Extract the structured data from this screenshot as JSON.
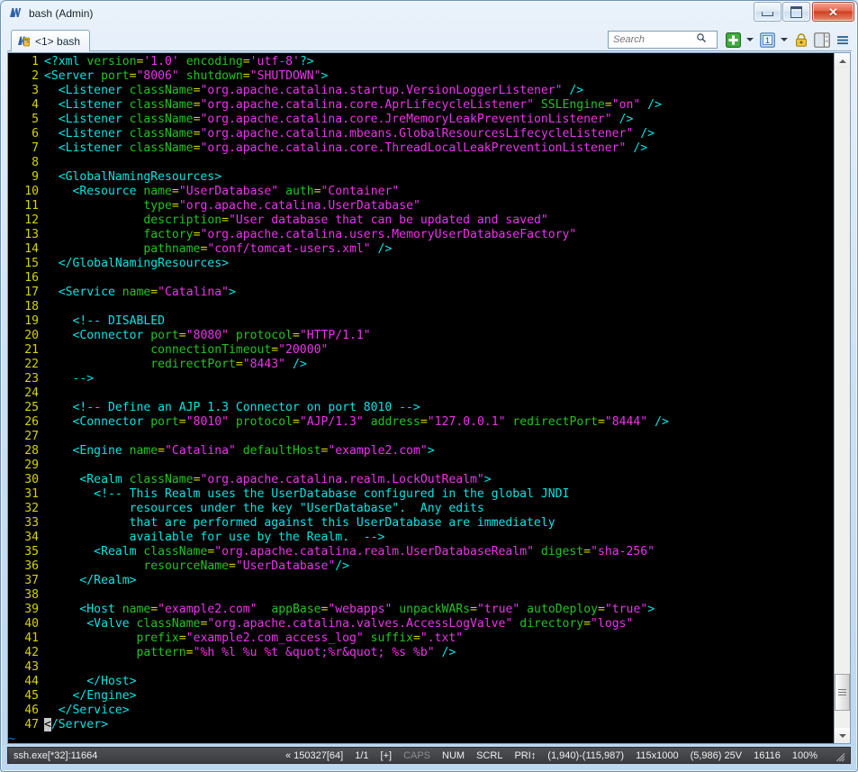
{
  "window": {
    "title": "bash (Admin)",
    "icon": "mobaxterm-icon",
    "buttons": {
      "minimize": "minimize-button",
      "maximize": "maximize-button",
      "close": "✕"
    }
  },
  "tabs": [
    {
      "label": "<1> bash",
      "icon": "terminal-session-icon",
      "active": true
    }
  ],
  "toolbar": {
    "search": {
      "placeholder": "Search",
      "value": ""
    },
    "search_icon": "magnifier-icon",
    "new_session_icon": "green-plus-icon",
    "new_session_caret": "▾",
    "split_count_label": "1",
    "split_caret": "▾",
    "lock_icon": "padlock-icon",
    "panes_icon": "split-panes-icon",
    "menu_icon": "hamburger-menu-icon"
  },
  "statusbar": {
    "process": "ssh.exe[*32]:11664",
    "session_marker": "«",
    "build": "150327[64]",
    "pane_ratio": "1/1",
    "expand": "[+]",
    "caps": "CAPS",
    "num": "NUM",
    "scrl": "SCRL",
    "pri": "PRI↕",
    "range": "(1,940)-(115,987)",
    "size": "115x1000",
    "position": "(5,986) 25V",
    "bytes": "16116",
    "zoom": "100%"
  },
  "scrollbar": {
    "up_arrow": "scroll-up-arrow",
    "down_arrow": "scroll-down-arrow",
    "thumb": "scroll-thumb"
  },
  "terminal": {
    "cursor_char": "<",
    "tilde_row": "~",
    "colors": {
      "background": "#000000",
      "line_number": "#d4d400",
      "tag": "#00e5e5",
      "attribute": "#22c422",
      "value": "#ee33ee",
      "cursor": "#c8c8c8",
      "tilde": "#1e7fdd"
    },
    "lines": [
      {
        "n": 1,
        "seg": [
          [
            "tag",
            "<?xml "
          ],
          [
            "attr",
            "version"
          ],
          [
            "eq",
            "="
          ],
          [
            "val",
            "'1.0'"
          ],
          [
            "tag",
            " "
          ],
          [
            "attr",
            "encoding"
          ],
          [
            "eq",
            "="
          ],
          [
            "val",
            "'utf-8'"
          ],
          [
            "tag",
            "?>"
          ]
        ]
      },
      {
        "n": 2,
        "seg": [
          [
            "tag",
            "<Server "
          ],
          [
            "attr",
            "port"
          ],
          [
            "eq",
            "="
          ],
          [
            "val",
            "\"8006\""
          ],
          [
            "tag",
            " "
          ],
          [
            "attr",
            "shutdown"
          ],
          [
            "eq",
            "="
          ],
          [
            "val",
            "\"SHUTDOWN\""
          ],
          [
            "tag",
            ">"
          ]
        ]
      },
      {
        "n": 3,
        "seg": [
          [
            "tag",
            "  <Listener "
          ],
          [
            "attr",
            "className"
          ],
          [
            "eq",
            "="
          ],
          [
            "val",
            "\"org.apache.catalina.startup.VersionLoggerListener\""
          ],
          [
            "tag",
            " />"
          ]
        ]
      },
      {
        "n": 4,
        "seg": [
          [
            "tag",
            "  <Listener "
          ],
          [
            "attr",
            "className"
          ],
          [
            "eq",
            "="
          ],
          [
            "val",
            "\"org.apache.catalina.core.AprLifecycleListener\""
          ],
          [
            "tag",
            " "
          ],
          [
            "attr",
            "SSLEngine"
          ],
          [
            "eq",
            "="
          ],
          [
            "val",
            "\"on\""
          ],
          [
            "tag",
            " />"
          ]
        ]
      },
      {
        "n": 5,
        "seg": [
          [
            "tag",
            "  <Listener "
          ],
          [
            "attr",
            "className"
          ],
          [
            "eq",
            "="
          ],
          [
            "val",
            "\"org.apache.catalina.core.JreMemoryLeakPreventionListener\""
          ],
          [
            "tag",
            " />"
          ]
        ]
      },
      {
        "n": 6,
        "seg": [
          [
            "tag",
            "  <Listener "
          ],
          [
            "attr",
            "className"
          ],
          [
            "eq",
            "="
          ],
          [
            "val",
            "\"org.apache.catalina.mbeans.GlobalResourcesLifecycleListener\""
          ],
          [
            "tag",
            " />"
          ]
        ]
      },
      {
        "n": 7,
        "seg": [
          [
            "tag",
            "  <Listener "
          ],
          [
            "attr",
            "className"
          ],
          [
            "eq",
            "="
          ],
          [
            "val",
            "\"org.apache.catalina.core.ThreadLocalLeakPreventionListener\""
          ],
          [
            "tag",
            " />"
          ]
        ]
      },
      {
        "n": 8,
        "seg": []
      },
      {
        "n": 9,
        "seg": [
          [
            "tag",
            "  <GlobalNamingResources>"
          ]
        ]
      },
      {
        "n": 10,
        "seg": [
          [
            "tag",
            "    <Resource "
          ],
          [
            "attr",
            "name"
          ],
          [
            "eq",
            "="
          ],
          [
            "val",
            "\"UserDatabase\""
          ],
          [
            "tag",
            " "
          ],
          [
            "attr",
            "auth"
          ],
          [
            "eq",
            "="
          ],
          [
            "val",
            "\"Container\""
          ]
        ]
      },
      {
        "n": 11,
        "seg": [
          [
            "tag",
            "              "
          ],
          [
            "attr",
            "type"
          ],
          [
            "eq",
            "="
          ],
          [
            "val",
            "\"org.apache.catalina.UserDatabase\""
          ]
        ]
      },
      {
        "n": 12,
        "seg": [
          [
            "tag",
            "              "
          ],
          [
            "attr",
            "description"
          ],
          [
            "eq",
            "="
          ],
          [
            "val",
            "\"User database that can be updated and saved\""
          ]
        ]
      },
      {
        "n": 13,
        "seg": [
          [
            "tag",
            "              "
          ],
          [
            "attr",
            "factory"
          ],
          [
            "eq",
            "="
          ],
          [
            "val",
            "\"org.apache.catalina.users.MemoryUserDatabaseFactory\""
          ]
        ]
      },
      {
        "n": 14,
        "seg": [
          [
            "tag",
            "              "
          ],
          [
            "attr",
            "pathname"
          ],
          [
            "eq",
            "="
          ],
          [
            "val",
            "\"conf/tomcat-users.xml\""
          ],
          [
            "tag",
            " />"
          ]
        ]
      },
      {
        "n": 15,
        "seg": [
          [
            "tag",
            "  </GlobalNamingResources>"
          ]
        ]
      },
      {
        "n": 16,
        "seg": []
      },
      {
        "n": 17,
        "seg": [
          [
            "tag",
            "  <Service "
          ],
          [
            "attr",
            "name"
          ],
          [
            "eq",
            "="
          ],
          [
            "val",
            "\"Catalina\""
          ],
          [
            "tag",
            ">"
          ]
        ]
      },
      {
        "n": 18,
        "seg": []
      },
      {
        "n": 19,
        "seg": [
          [
            "tag",
            "    <!-- DISABLED"
          ]
        ]
      },
      {
        "n": 20,
        "seg": [
          [
            "tag",
            "    <Connector "
          ],
          [
            "attr",
            "port"
          ],
          [
            "eq",
            "="
          ],
          [
            "val",
            "\"8080\""
          ],
          [
            "tag",
            " "
          ],
          [
            "attr",
            "protocol"
          ],
          [
            "eq",
            "="
          ],
          [
            "val",
            "\"HTTP/1.1\""
          ]
        ]
      },
      {
        "n": 21,
        "seg": [
          [
            "tag",
            "               "
          ],
          [
            "attr",
            "connectionTimeout"
          ],
          [
            "eq",
            "="
          ],
          [
            "val",
            "\"20000\""
          ]
        ]
      },
      {
        "n": 22,
        "seg": [
          [
            "tag",
            "               "
          ],
          [
            "attr",
            "redirectPort"
          ],
          [
            "eq",
            "="
          ],
          [
            "val",
            "\"8443\""
          ],
          [
            "tag",
            " />"
          ]
        ]
      },
      {
        "n": 23,
        "seg": [
          [
            "tag",
            "    -->"
          ]
        ]
      },
      {
        "n": 24,
        "seg": []
      },
      {
        "n": 25,
        "seg": [
          [
            "tag",
            "    <!-- Define an AJP 1.3 Connector on port 8010 -->"
          ]
        ]
      },
      {
        "n": 26,
        "seg": [
          [
            "tag",
            "    <Connector "
          ],
          [
            "attr",
            "port"
          ],
          [
            "eq",
            "="
          ],
          [
            "val",
            "\"8010\""
          ],
          [
            "tag",
            " "
          ],
          [
            "attr",
            "protocol"
          ],
          [
            "eq",
            "="
          ],
          [
            "val",
            "\"AJP/1.3\""
          ],
          [
            "tag",
            " "
          ],
          [
            "attr",
            "address"
          ],
          [
            "eq",
            "="
          ],
          [
            "val",
            "\"127.0.0.1\""
          ],
          [
            "tag",
            " "
          ],
          [
            "attr",
            "redirectPort"
          ],
          [
            "eq",
            "="
          ],
          [
            "val",
            "\"8444\""
          ],
          [
            "tag",
            " />"
          ]
        ]
      },
      {
        "n": 27,
        "seg": []
      },
      {
        "n": 28,
        "seg": [
          [
            "tag",
            "    <Engine "
          ],
          [
            "attr",
            "name"
          ],
          [
            "eq",
            "="
          ],
          [
            "val",
            "\"Catalina\""
          ],
          [
            "tag",
            " "
          ],
          [
            "attr",
            "defaultHost"
          ],
          [
            "eq",
            "="
          ],
          [
            "val",
            "\"example2.com\""
          ],
          [
            "tag",
            ">"
          ]
        ]
      },
      {
        "n": 29,
        "seg": []
      },
      {
        "n": 30,
        "seg": [
          [
            "tag",
            "     <Realm "
          ],
          [
            "attr",
            "className"
          ],
          [
            "eq",
            "="
          ],
          [
            "val",
            "\"org.apache.catalina.realm.LockOutRealm\""
          ],
          [
            "tag",
            ">"
          ]
        ]
      },
      {
        "n": 31,
        "seg": [
          [
            "tag",
            "       <!-- This Realm uses the UserDatabase configured in the global JNDI"
          ]
        ]
      },
      {
        "n": 32,
        "seg": [
          [
            "tag",
            "            resources under the key \"UserDatabase\".  Any edits"
          ]
        ]
      },
      {
        "n": 33,
        "seg": [
          [
            "tag",
            "            that are performed against this UserDatabase are immediately"
          ]
        ]
      },
      {
        "n": 34,
        "seg": [
          [
            "tag",
            "            available for use by the Realm.  -->"
          ]
        ]
      },
      {
        "n": 35,
        "seg": [
          [
            "tag",
            "       <Realm "
          ],
          [
            "attr",
            "className"
          ],
          [
            "eq",
            "="
          ],
          [
            "val",
            "\"org.apache.catalina.realm.UserDatabaseRealm\""
          ],
          [
            "tag",
            " "
          ],
          [
            "attr",
            "digest"
          ],
          [
            "eq",
            "="
          ],
          [
            "val",
            "\"sha-256\""
          ]
        ]
      },
      {
        "n": 36,
        "seg": [
          [
            "tag",
            "              "
          ],
          [
            "attr",
            "resourceName"
          ],
          [
            "eq",
            "="
          ],
          [
            "val",
            "\"UserDatabase\""
          ],
          [
            "tag",
            "/>"
          ]
        ]
      },
      {
        "n": 37,
        "seg": [
          [
            "tag",
            "     </Realm>"
          ]
        ]
      },
      {
        "n": 38,
        "seg": []
      },
      {
        "n": 39,
        "seg": [
          [
            "tag",
            "     <Host "
          ],
          [
            "attr",
            "name"
          ],
          [
            "eq",
            "="
          ],
          [
            "val",
            "\"example2.com\""
          ],
          [
            "tag",
            "  "
          ],
          [
            "attr",
            "appBase"
          ],
          [
            "eq",
            "="
          ],
          [
            "val",
            "\"webapps\""
          ],
          [
            "tag",
            " "
          ],
          [
            "attr",
            "unpackWARs"
          ],
          [
            "eq",
            "="
          ],
          [
            "val",
            "\"true\""
          ],
          [
            "tag",
            " "
          ],
          [
            "attr",
            "autoDeploy"
          ],
          [
            "eq",
            "="
          ],
          [
            "val",
            "\"true\""
          ],
          [
            "tag",
            ">"
          ]
        ]
      },
      {
        "n": 40,
        "seg": [
          [
            "tag",
            "      <Valve "
          ],
          [
            "attr",
            "className"
          ],
          [
            "eq",
            "="
          ],
          [
            "val",
            "\"org.apache.catalina.valves.AccessLogValve\""
          ],
          [
            "tag",
            " "
          ],
          [
            "attr",
            "directory"
          ],
          [
            "eq",
            "="
          ],
          [
            "val",
            "\"logs\""
          ]
        ]
      },
      {
        "n": 41,
        "seg": [
          [
            "tag",
            "             "
          ],
          [
            "attr",
            "prefix"
          ],
          [
            "eq",
            "="
          ],
          [
            "val",
            "\"example2.com_access_log\""
          ],
          [
            "tag",
            " "
          ],
          [
            "attr",
            "suffix"
          ],
          [
            "eq",
            "="
          ],
          [
            "val",
            "\".txt\""
          ]
        ]
      },
      {
        "n": 42,
        "seg": [
          [
            "tag",
            "             "
          ],
          [
            "attr",
            "pattern"
          ],
          [
            "eq",
            "="
          ],
          [
            "val",
            "\"%h %l %u %t &quot;%r&quot; %s %b\""
          ],
          [
            "tag",
            " />"
          ]
        ]
      },
      {
        "n": 43,
        "seg": []
      },
      {
        "n": 44,
        "seg": [
          [
            "tag",
            "      </Host>"
          ]
        ]
      },
      {
        "n": 45,
        "seg": [
          [
            "tag",
            "    </Engine>"
          ]
        ]
      },
      {
        "n": 46,
        "seg": [
          [
            "tag",
            "  </Service>"
          ]
        ]
      },
      {
        "n": 47,
        "seg": [
          [
            "cursor",
            "<"
          ],
          [
            "tag",
            "/Server>"
          ]
        ]
      }
    ]
  }
}
